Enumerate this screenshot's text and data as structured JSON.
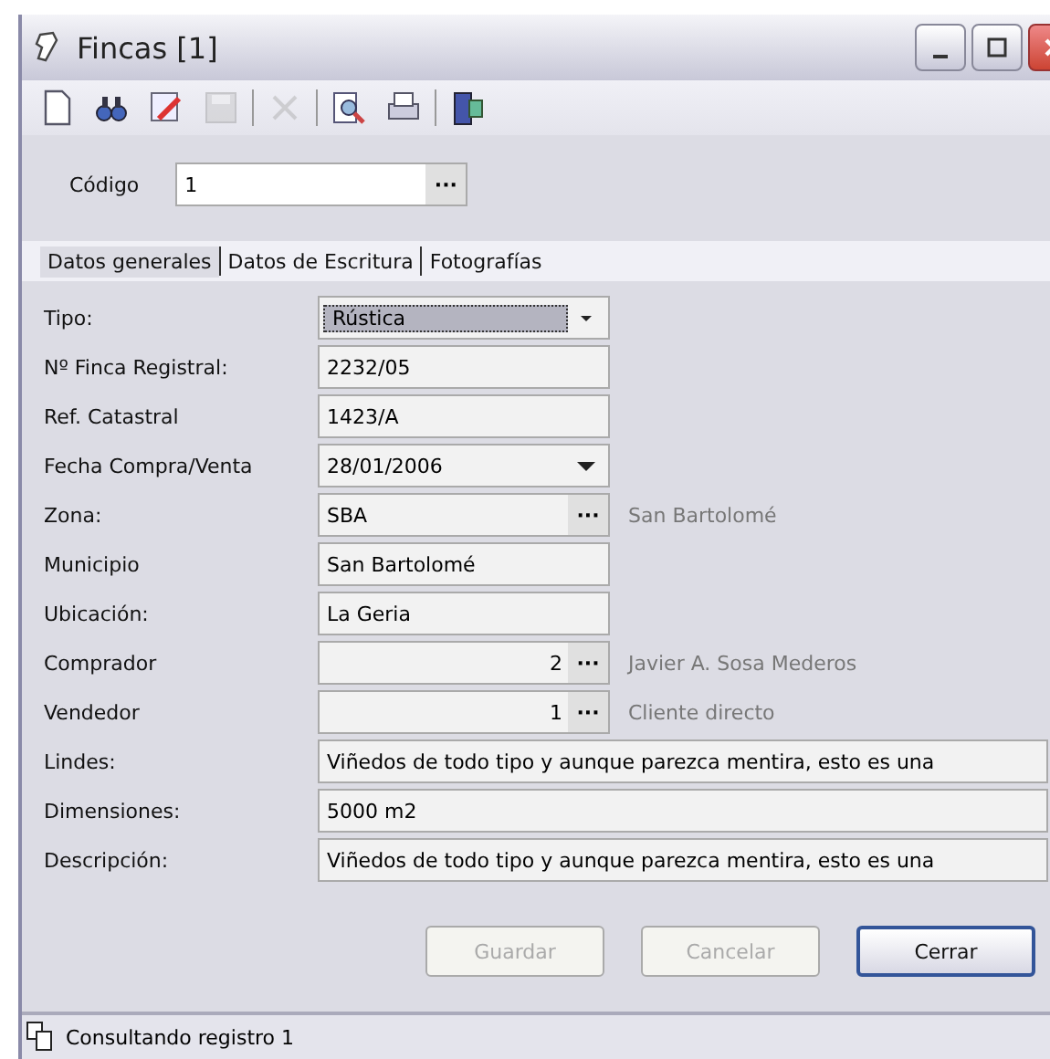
{
  "window": {
    "title": "Fincas [1]"
  },
  "toolbar": [
    {
      "kind": "new",
      "disabled": false
    },
    {
      "kind": "find",
      "disabled": false
    },
    {
      "kind": "edit",
      "disabled": false
    },
    {
      "kind": "save",
      "disabled": true
    },
    {
      "kind": "separator"
    },
    {
      "kind": "delete",
      "disabled": true
    },
    {
      "kind": "separator"
    },
    {
      "kind": "preview",
      "disabled": false
    },
    {
      "kind": "print",
      "disabled": false
    },
    {
      "kind": "separator"
    },
    {
      "kind": "exit",
      "disabled": false
    }
  ],
  "code": {
    "label": "Código",
    "value": "1",
    "button": "···"
  },
  "tabs": [
    {
      "label": "Datos generales",
      "selected": true
    },
    {
      "label": "Datos de Escritura",
      "selected": false
    },
    {
      "label": "Fotografías",
      "selected": false
    }
  ],
  "fields": [
    {
      "kind": "combo",
      "label": "Tipo:",
      "value": "Rústica",
      "focused": true
    },
    {
      "kind": "text",
      "label": "Nº Finca Registral:",
      "value": "2232/05"
    },
    {
      "kind": "text",
      "label": "Ref. Catastral",
      "value": "1423/A"
    },
    {
      "kind": "date",
      "label": "Fecha Compra/Venta",
      "value": "28/01/2006"
    },
    {
      "kind": "lookup",
      "label": "Zona:",
      "value": "SBA",
      "button": "···",
      "note": "San Bartolomé"
    },
    {
      "kind": "text",
      "label": "Municipio",
      "value": "San Bartolomé"
    },
    {
      "kind": "text",
      "label": "Ubicación:",
      "value": "La Geria"
    },
    {
      "kind": "idlookup",
      "label": "Comprador",
      "value": "2",
      "button": "···",
      "note": "Javier A. Sosa Mederos"
    },
    {
      "kind": "idlookup",
      "label": "Vendedor",
      "value": "1",
      "button": "···",
      "note": "Cliente directo"
    },
    {
      "kind": "wide",
      "label": "Lindes:",
      "value": "Viñedos de todo tipo y aunque parezca mentira, esto es una"
    },
    {
      "kind": "wide",
      "label": "Dimensiones:",
      "value": "5000 m2"
    },
    {
      "kind": "wide",
      "label": "Descripción:",
      "value": "Viñedos de todo tipo y aunque parezca mentira, esto es una"
    }
  ],
  "buttons": [
    {
      "label": "Guardar",
      "disabled": true,
      "default": false
    },
    {
      "label": "Cancelar",
      "disabled": true,
      "default": false
    },
    {
      "label": "Cerrar",
      "disabled": false,
      "default": true
    }
  ],
  "status_bar": {
    "text": "Consultando registro 1"
  }
}
